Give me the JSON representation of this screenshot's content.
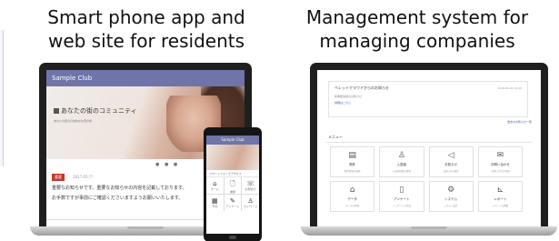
{
  "captions": {
    "left": [
      "Smart phone app and",
      "web site for residents"
    ],
    "right": [
      "Management system for",
      "managing companies"
    ]
  },
  "resident_site": {
    "brand": "Sample Club",
    "hero_title": "あなたの街のコミュニティ",
    "hero_sub": "あなたの街の日常的な交流の場",
    "dots": "● ● ●",
    "news_tag": "重要",
    "news_date": "2017.05.??",
    "news_text": [
      "重要なお知らせです。重要なお知らせの内容を記載しております。",
      "お手数ですが事前にご確認くださいますようお願いいたします。"
    ]
  },
  "phone_app": {
    "brand": "Sample Club",
    "line1": "スマートフォンでアクセス",
    "tiles": [
      {
        "icon": "home-icon",
        "glyph": "⌂",
        "label": "ホーム"
      },
      {
        "icon": "document-icon",
        "glyph": "🗋",
        "label": "書類"
      },
      {
        "icon": "chat-icon",
        "glyph": "☏",
        "label": "お問合せ"
      },
      {
        "icon": "calendar-icon",
        "glyph": "▦",
        "label": "予約"
      },
      {
        "icon": "edit-icon",
        "glyph": "✎",
        "label": "アンケート"
      },
      {
        "icon": "user-icon",
        "glyph": "♙",
        "label": "マイページ"
      }
    ]
  },
  "management_system": {
    "banner_title": "ベレットクラウドからのお知らせ",
    "banner_line1": "新機能追加のお知らせ",
    "banner_line2": "詳細はこちら",
    "banner_date": "2018.06.20 10:00",
    "link": "過去のお知らせ一覧",
    "menu_title": "メニュー",
    "tiles": [
      {
        "icon": "building-icon",
        "glyph": "▤",
        "title": "物件",
        "desc": "物件情報の管理"
      },
      {
        "icon": "person-icon",
        "glyph": "♙",
        "title": "入居者",
        "desc": "入居者情報の管理"
      },
      {
        "icon": "megaphone-icon",
        "glyph": "◁",
        "title": "お知らせ",
        "desc": "お知らせの配信"
      },
      {
        "icon": "mail-icon",
        "glyph": "✉",
        "title": "お問い合わせ",
        "desc": "お問い合わせ管理"
      },
      {
        "icon": "home-icon",
        "glyph": "⌂",
        "title": "データ",
        "desc": "データの管理"
      },
      {
        "icon": "clipboard-icon",
        "glyph": "▯",
        "title": "アンケート",
        "desc": "アンケートの作成"
      },
      {
        "icon": "gear-icon",
        "glyph": "⚙",
        "title": "システム",
        "desc": "システム設定"
      },
      {
        "icon": "chart-icon",
        "glyph": "⊾",
        "title": "レポート",
        "desc": "レポートの閲覧"
      }
    ]
  }
}
